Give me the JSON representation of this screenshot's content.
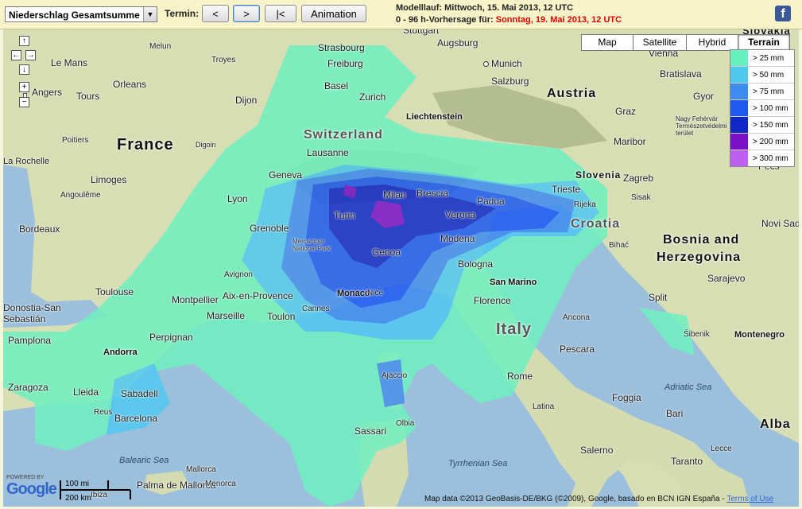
{
  "toolbar": {
    "parameter_select": "Niederschlag Gesamtsumme",
    "termin_label": "Termin:",
    "prev_label": "<",
    "next_label": ">",
    "first_label": "|<",
    "animation_label": "Animation",
    "run_line": "Modelllauf: Mittwoch, 15. Mai 2013, 12 UTC",
    "forecast_prefix": "0 - 96 h-Vorhersage für:",
    "forecast_date": "Sonntag, 19. Mai 2013, 12 UTC",
    "facebook_icon": "f"
  },
  "map_types": [
    {
      "label": "Map",
      "active": false
    },
    {
      "label": "Satellite",
      "active": false
    },
    {
      "label": "Hybrid",
      "active": false
    },
    {
      "label": "Terrain",
      "active": true
    }
  ],
  "legend": [
    {
      "label": "> 25 mm",
      "color": "#66f0c0"
    },
    {
      "label": "> 50 mm",
      "color": "#4fc8f0"
    },
    {
      "label": "> 75 mm",
      "color": "#3f8cf0"
    },
    {
      "label": "> 100 mm",
      "color": "#1e5af0"
    },
    {
      "label": "> 150 mm",
      "color": "#1028c8"
    },
    {
      "label": "> 200 mm",
      "color": "#7a10c8"
    },
    {
      "label": "> 300 mm",
      "color": "#c060f0"
    }
  ],
  "nav": {
    "up": "↑",
    "left": "←",
    "right": "→",
    "down": "↓",
    "zoom_in": "+",
    "zoom_out": "−"
  },
  "countries": [
    {
      "name": "France"
    },
    {
      "name": "Switzerland"
    },
    {
      "name": "Austria"
    },
    {
      "name": "Italy"
    },
    {
      "name": "Croatia"
    },
    {
      "name": "Bosnia and"
    },
    {
      "name": "Herzegovina"
    },
    {
      "name": "Slovenia"
    },
    {
      "name": "Slovakia"
    },
    {
      "name": "Liechtenstein"
    },
    {
      "name": "San Marino"
    },
    {
      "name": "Andorra"
    },
    {
      "name": "Monaco"
    },
    {
      "name": "Montenegro"
    },
    {
      "name": "Alba"
    }
  ],
  "cities": [
    "Stuttgart",
    "Augsburg",
    "Munich",
    "Vienna",
    "Strasbourg",
    "Freiburg",
    "Salzburg",
    "Bratislava",
    "Le Mans",
    "Troyes",
    "Melun",
    "Basel",
    "Zurich",
    "Orleans",
    "Angers",
    "Tours",
    "Dijon",
    "Gyor",
    "Graz",
    "Nagy Fehérvár Természetvédelmi terület",
    "Poitiers",
    "Maribor",
    "La Rochelle",
    "Digoin",
    "Lausanne",
    "Geneva",
    "Limoges",
    "Pécs",
    "Angoulême",
    "Lyon",
    "Milan",
    "Brescia",
    "Zagreb",
    "Trieste",
    "Sisak",
    "Padua",
    "Verona",
    "Rijeka",
    "Bordeaux",
    "Grenoble",
    "Turin",
    "Modena",
    "Novi Sad",
    "Genoa",
    "Bihać",
    "Bologna",
    "Avignon",
    "Mercantour National Park",
    "Toulouse",
    "Montpellier",
    "Aix-en-Provence",
    "Nice",
    "Florence",
    "Sarajevo",
    "Split",
    "Marseille",
    "Toulon",
    "Cannes",
    "Donostia-San Sebastián",
    "Pamplona",
    "Perpignan",
    "Pescara",
    "Ancona",
    "Šibenik",
    "Zaragoza",
    "Lleida",
    "Sabadell",
    "Rome",
    "Foggia",
    "Bari",
    "Reus",
    "Barcelona",
    "Latina",
    "Salerno",
    "Taranto",
    "Sassari",
    "Olbia",
    "Ajaccio",
    "Mallorca",
    "Palma de Mallorca",
    "Menorca",
    "Ibiza",
    "Lecce"
  ],
  "seas": [
    "Balearic Sea",
    "Adriatic Sea",
    "Tyrrhenian Sea"
  ],
  "scale": {
    "line1": "100 mi",
    "line2": "200 km"
  },
  "footer": {
    "powered": "POWERED BY",
    "google": "Google",
    "attribution": "Map data ©2013 GeoBasis-DE/BKG (©2009), Google, basado en BCN IGN España - ",
    "terms": "Terms of Use"
  }
}
